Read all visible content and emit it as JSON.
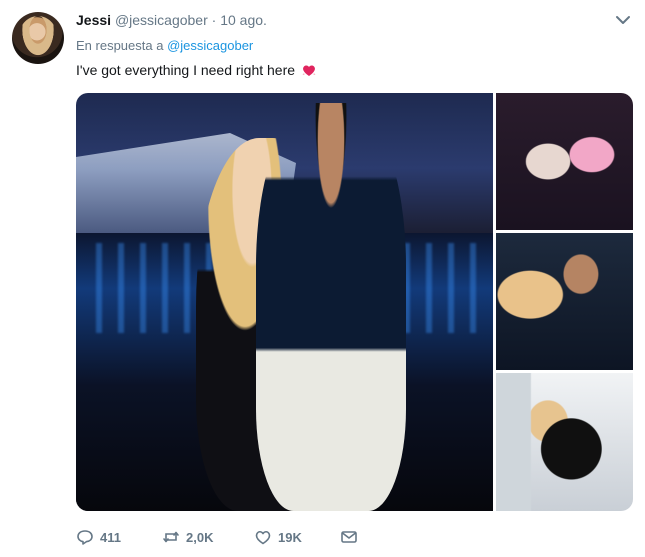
{
  "tweet": {
    "name": "Jessi",
    "handle": "@jessicagober",
    "separator": "·",
    "time": "10 ago.",
    "reply_prefix": "En respuesta a",
    "reply_to": "@jessicagober",
    "text": "I've got everything I need right here",
    "emoji": "heart-with-ribbon-icon"
  },
  "actions": {
    "replies": "411",
    "retweets": "2,0K",
    "likes": "19K"
  },
  "colors": {
    "text": "#14171a",
    "muted": "#657786",
    "link": "#1b95e0",
    "background": "#ffffff"
  }
}
